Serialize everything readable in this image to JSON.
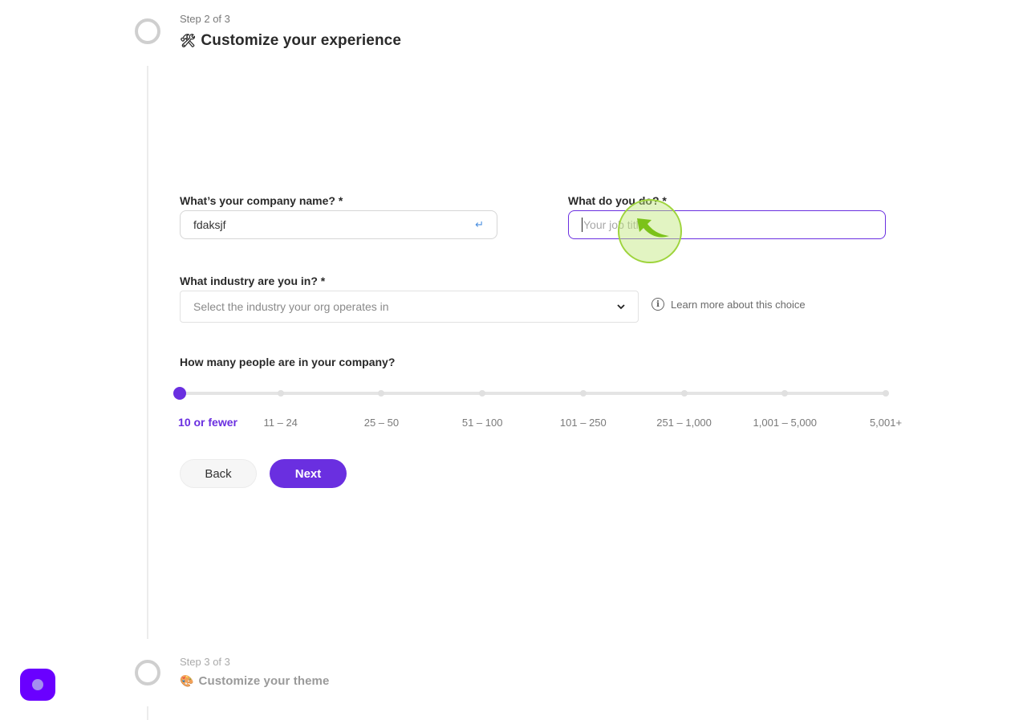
{
  "steps": [
    {
      "meta": "Step 2 of 3",
      "icon": "tools-icon",
      "icon_glyph": "🛠",
      "title": "Customize your experience",
      "state": "current"
    },
    {
      "meta": "Step 3 of 3",
      "icon": "palette-icon",
      "icon_glyph": "🎨",
      "title": "Customize your theme",
      "state": "upcoming"
    }
  ],
  "form": {
    "company_name": {
      "label": "What’s your company name? *",
      "value": "fdaksjf",
      "submit_hint_glyph": "↵"
    },
    "job_title": {
      "label": "What do you do? *",
      "placeholder": "Your job title",
      "value": ""
    },
    "industry": {
      "label": "What industry are you in? *",
      "placeholder": "Select the industry your org operates in",
      "learn_more": "Learn more about this choice"
    },
    "company_size": {
      "label": "How many people are in your company?",
      "options": [
        "10 or fewer",
        "11 – 24",
        "25 – 50",
        "51 – 100",
        "101 – 250",
        "251 – 1,000",
        "1,001 – 5,000",
        "5,001+"
      ],
      "selected_index": 0
    }
  },
  "buttons": {
    "back": "Back",
    "next": "Next"
  },
  "colors": {
    "accent": "#6a2fe0",
    "click_indicator": "#9ed43c",
    "fab": "#6a00ff"
  }
}
